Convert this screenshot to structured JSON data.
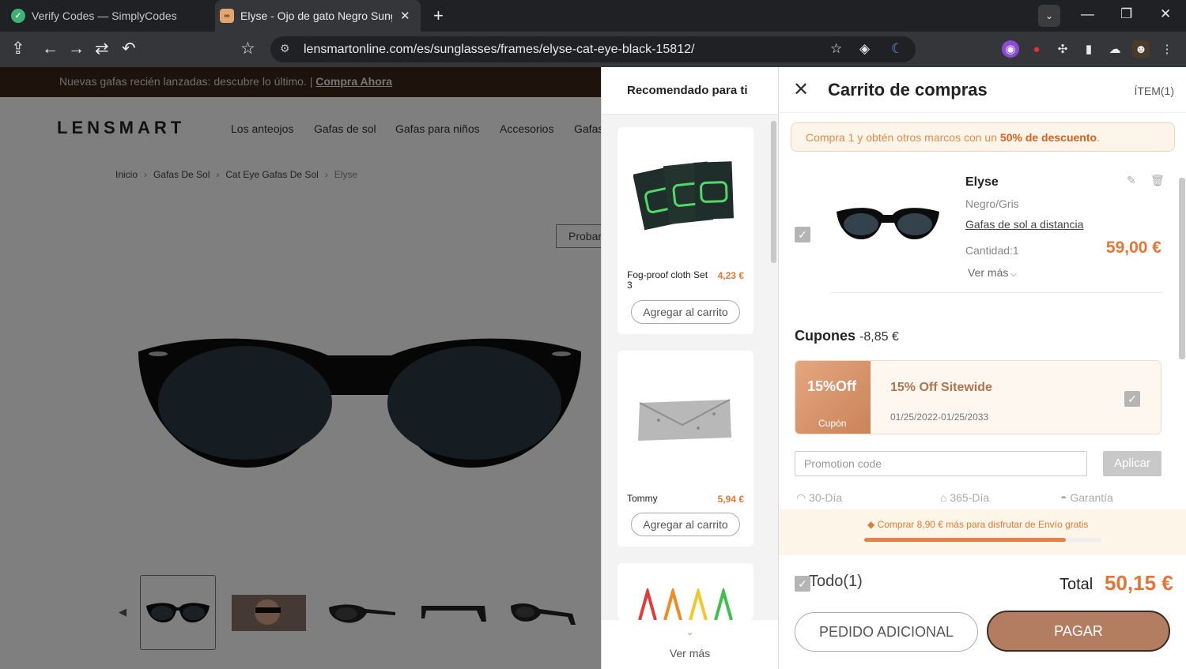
{
  "browser": {
    "tabs": [
      {
        "title": "Verify Codes — SimplyCodes",
        "icon": "check-circle-icon"
      },
      {
        "title": "Elyse - Ojo de gato Negro Sunglasses",
        "icon": "glasses-icon"
      }
    ],
    "url": "lensmartonline.com/es/sunglasses/frames/elyse-cat-eye-black-15812/"
  },
  "page": {
    "banner_text": "Nuevas gafas recién lanzadas: descubre lo último. | ",
    "banner_link": "Compra Ahora",
    "logo": "LENSMART",
    "nav": [
      "Los anteojos",
      "Gafas de sol",
      "Gafas para niños",
      "Accesorios",
      "Gafas"
    ],
    "breadcrumb": [
      "Inicio",
      "Gafas De Sol",
      "Cat Eye Gafas De Sol",
      "Elyse"
    ],
    "try_on": "Probar"
  },
  "recommend": {
    "title": "Recomendado para ti",
    "items": [
      {
        "name": "Fog-proof cloth Set 3",
        "price": "4,23 €",
        "button": "Agregar al carrito"
      },
      {
        "name": "Tommy",
        "price": "5,94 €",
        "button": "Agregar al carrito"
      }
    ],
    "see_more": "Ver más"
  },
  "cart": {
    "title": "Carrito de compras",
    "count": "ÍTEM(1)",
    "promo_pre": "Compra 1 y obtén otros marcos con un ",
    "promo_bold": "50% de descuento",
    "promo_post": ".",
    "product": {
      "name": "Elyse",
      "color": "Negro/Gris",
      "type": "Gafas de sol a distancia",
      "qty": "Cantidad:1",
      "more": "Ver más",
      "price": "59,00 €"
    },
    "coupons_label": "Cupones",
    "coupons_value": "-8,85 €",
    "coupon": {
      "badge": "15%Off",
      "badge_label": "Cupón",
      "title": "15% Off Sitewide",
      "dates": "01/25/2022-01/25/2033"
    },
    "promo_placeholder": "Promotion code",
    "apply": "Aplicar",
    "services": [
      "30-Día",
      "365-Día",
      "Garantía"
    ],
    "shipping_text": "Comprar 8,90 € más para disfrutar de Envío gratis",
    "shipping_progress": 0.85,
    "select_all": "Todo(1)",
    "total_label": "Total",
    "total_value": "50,15 €",
    "add_order": "PEDIDO ADICIONAL",
    "pay": "PAGAR"
  },
  "colors": {
    "accent": "#e87434",
    "pay": "#b37d61"
  }
}
